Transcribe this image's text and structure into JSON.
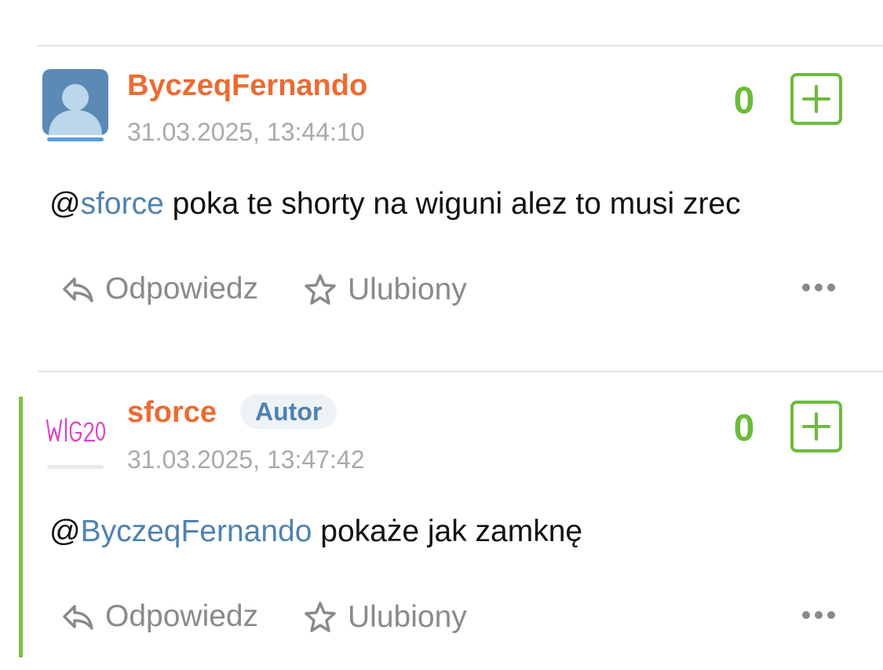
{
  "colors": {
    "username": "#ec6b32",
    "mention": "#4f82b2",
    "score": "#6dbb3c",
    "author_bar": "#7cbf4a",
    "timestamp": "#aaaaaa",
    "action": "#8a8a8a"
  },
  "comments": [
    {
      "username": "ByczeqFernando",
      "badge": "",
      "timestamp": "31.03.2025, 13:44:10",
      "score": "0",
      "avatar": "default-user-silhouette",
      "message": {
        "at": "@",
        "mention": "sforce",
        "text": " poka te shorty na wiguni alez to musi zrec"
      },
      "reply_label": "Odpowiedz",
      "favorite_label": "Ulubiony",
      "is_author": false
    },
    {
      "username": "sforce",
      "badge": "Autor",
      "timestamp": "31.03.2025, 13:47:42",
      "score": "0",
      "avatar": "handwritten-wig20-avatar",
      "avatar_text": "WIG20",
      "message": {
        "at": "@",
        "mention": "ByczeqFernando",
        "text": " pokaże jak zamknę"
      },
      "reply_label": "Odpowiedz",
      "favorite_label": "Ulubiony",
      "is_author": true
    }
  ],
  "icons": {
    "plus": "plus-square-icon",
    "reply": "reply-arrow-icon",
    "favorite": "star-outline-icon",
    "more": "more-dots-icon"
  }
}
